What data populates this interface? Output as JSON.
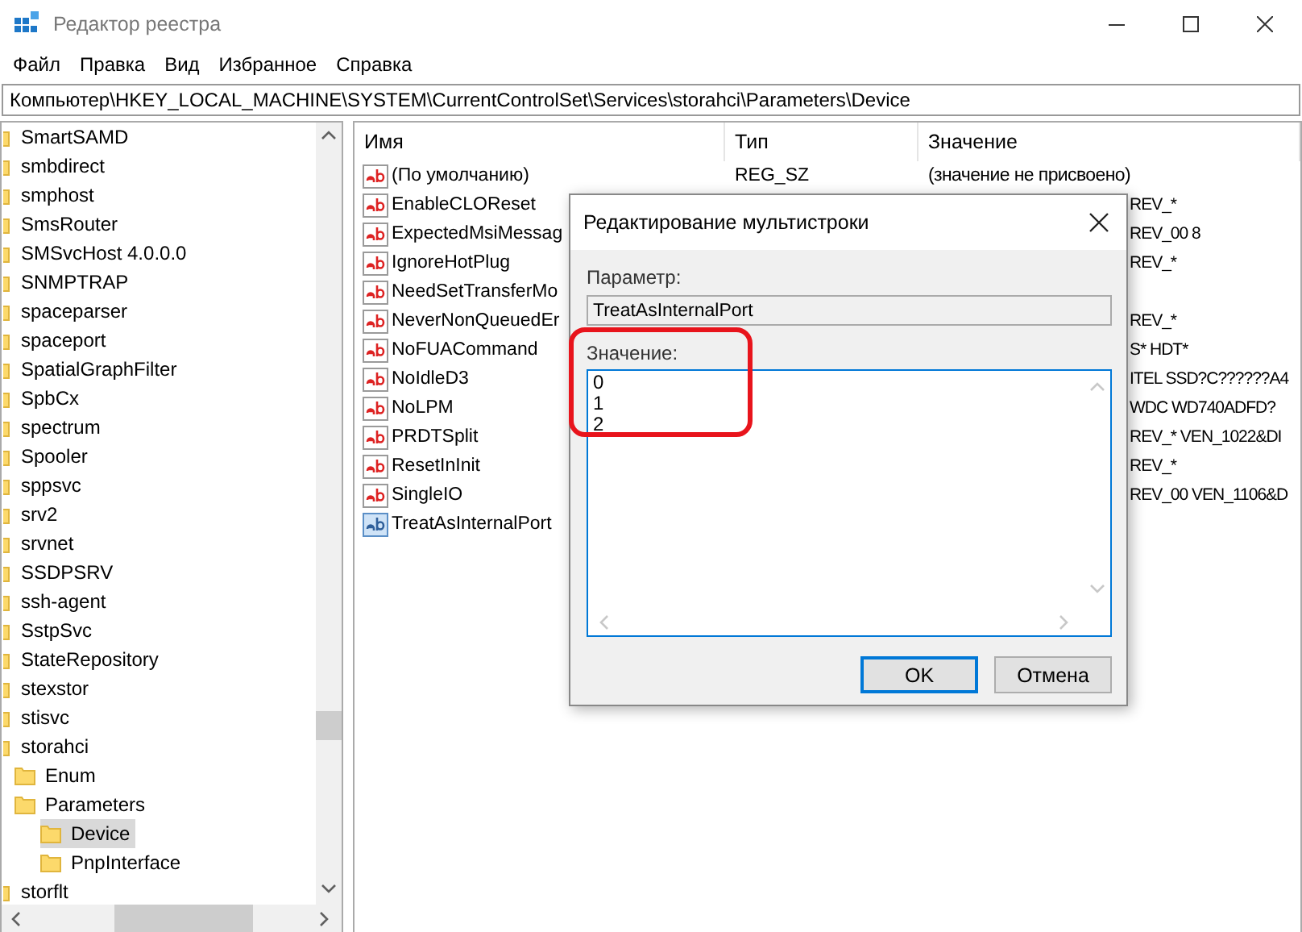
{
  "window": {
    "title": "Редактор реестра"
  },
  "menu": [
    "Файл",
    "Правка",
    "Вид",
    "Избранное",
    "Справка"
  ],
  "address": "Компьютер\\HKEY_LOCAL_MACHINE\\SYSTEM\\CurrentControlSet\\Services\\storahci\\Parameters\\Device",
  "tree": [
    {
      "label": "SmartSAMD",
      "selected": false
    },
    {
      "label": "smbdirect",
      "selected": false
    },
    {
      "label": "smphost",
      "selected": false
    },
    {
      "label": "SmsRouter",
      "selected": false
    },
    {
      "label": "SMSvcHost 4.0.0.0",
      "selected": false
    },
    {
      "label": "SNMPTRAP",
      "selected": false
    },
    {
      "label": "spaceparser",
      "selected": false
    },
    {
      "label": "spaceport",
      "selected": false
    },
    {
      "label": "SpatialGraphFilter",
      "selected": false
    },
    {
      "label": "SpbCx",
      "selected": false
    },
    {
      "label": "spectrum",
      "selected": false
    },
    {
      "label": "Spooler",
      "selected": false
    },
    {
      "label": "sppsvc",
      "selected": false
    },
    {
      "label": "srv2",
      "selected": false
    },
    {
      "label": "srvnet",
      "selected": false
    },
    {
      "label": "SSDPSRV",
      "selected": false
    },
    {
      "label": "ssh-agent",
      "selected": false
    },
    {
      "label": "SstpSvc",
      "selected": false
    },
    {
      "label": "StateRepository",
      "selected": false
    },
    {
      "label": "stexstor",
      "selected": false
    },
    {
      "label": "stisvc",
      "selected": false
    },
    {
      "label": "storahci",
      "selected": false,
      "children": [
        {
          "label": "Enum",
          "selected": false
        },
        {
          "label": "Parameters",
          "selected": false,
          "children": [
            {
              "label": "Device",
              "selected": true
            },
            {
              "label": "PnpInterface",
              "selected": false
            }
          ]
        }
      ]
    },
    {
      "label": "storflt",
      "selected": false
    }
  ],
  "values_table": {
    "columns": [
      "Имя",
      "Тип",
      "Значение"
    ],
    "rows": [
      {
        "name": "(По умолчанию)",
        "type": "REG_SZ",
        "value": "(значение не присвоено)",
        "selected": false
      },
      {
        "name": "EnableCLOReset",
        "value": "REV_*",
        "selected": false
      },
      {
        "name": "ExpectedMsiMessag",
        "value": "REV_00 8",
        "selected": false
      },
      {
        "name": "IgnoreHotPlug",
        "value": "REV_*",
        "selected": false
      },
      {
        "name": "NeedSetTransferMo",
        "selected": false
      },
      {
        "name": "NeverNonQueuedEr",
        "value": "REV_*",
        "selected": false
      },
      {
        "name": "NoFUACommand",
        "value": "S* HDT*",
        "selected": false
      },
      {
        "name": "NoIdleD3",
        "value": "ITEL SSD?C??????A4",
        "selected": false
      },
      {
        "name": "NoLPM",
        "value": "WDC WD740ADFD?",
        "selected": false
      },
      {
        "name": "PRDTSplit",
        "value": "REV_* VEN_1022&DI",
        "selected": false
      },
      {
        "name": "ResetInInit",
        "value": "REV_*",
        "selected": false
      },
      {
        "name": "SingleIO",
        "value": "REV_00 VEN_1106&D",
        "selected": false
      },
      {
        "name": "TreatAsInternalPort",
        "selected": true
      }
    ]
  },
  "dialog": {
    "title": "Редактирование мультистроки",
    "parameter_label": "Параметр:",
    "parameter_value": "TreatAsInternalPort",
    "value_label": "Значение:",
    "value_lines": [
      "0",
      "1",
      "2"
    ],
    "buttons": [
      {
        "label": "OK",
        "default": true
      },
      {
        "label": "Отмена",
        "default": false
      }
    ]
  }
}
